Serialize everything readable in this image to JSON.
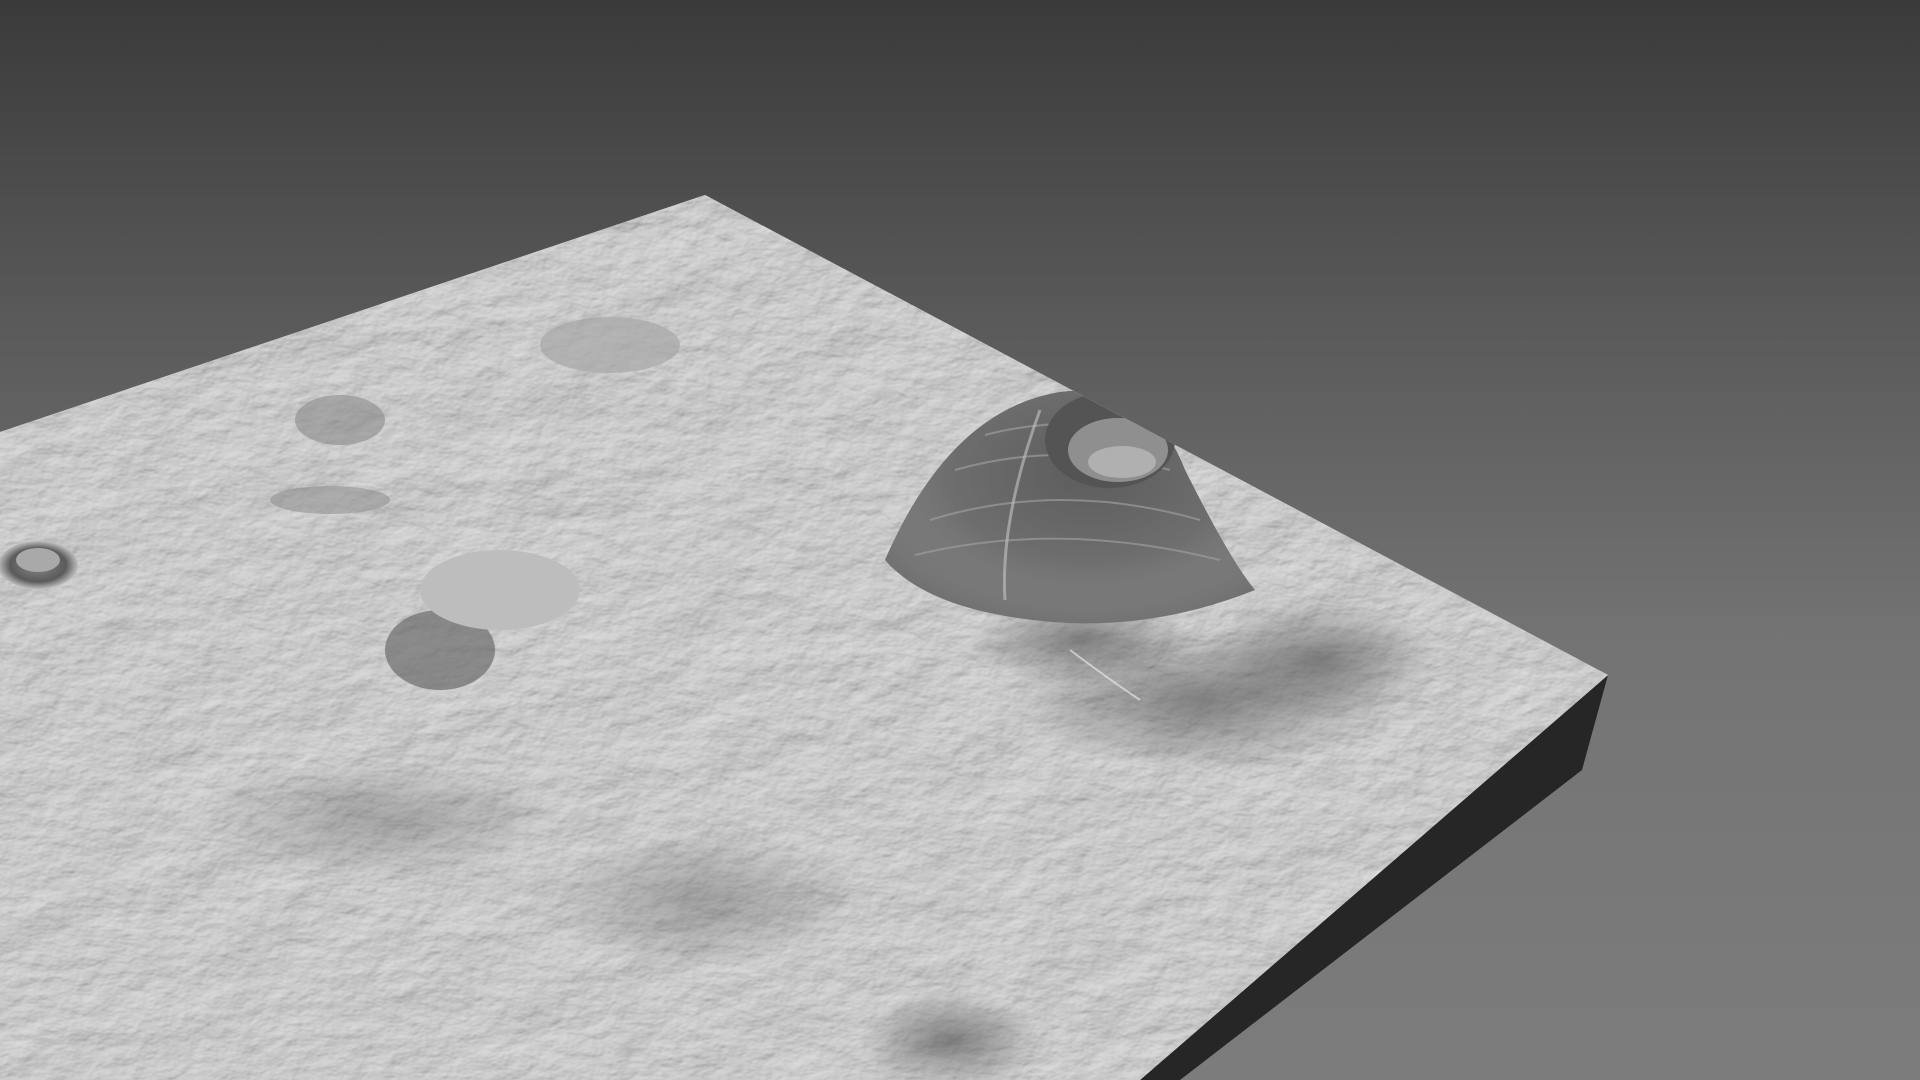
{
  "scene": {
    "subject": "terrain-heightmap-render",
    "colors": {
      "background_top": "#3a3a3a",
      "background_bottom": "#7c7c7c",
      "terrain_surface": "#d2d2d2",
      "terrain_shadow": "#6a6a6a",
      "slab_side": "#262626"
    },
    "features": [
      {
        "name": "volcanic-cone",
        "type": "cone-with-crater"
      },
      {
        "name": "small-crater",
        "type": "crater"
      },
      {
        "name": "mesa-ridge",
        "type": "ridge"
      },
      {
        "name": "lava-flows",
        "type": "flow-field"
      }
    ]
  }
}
